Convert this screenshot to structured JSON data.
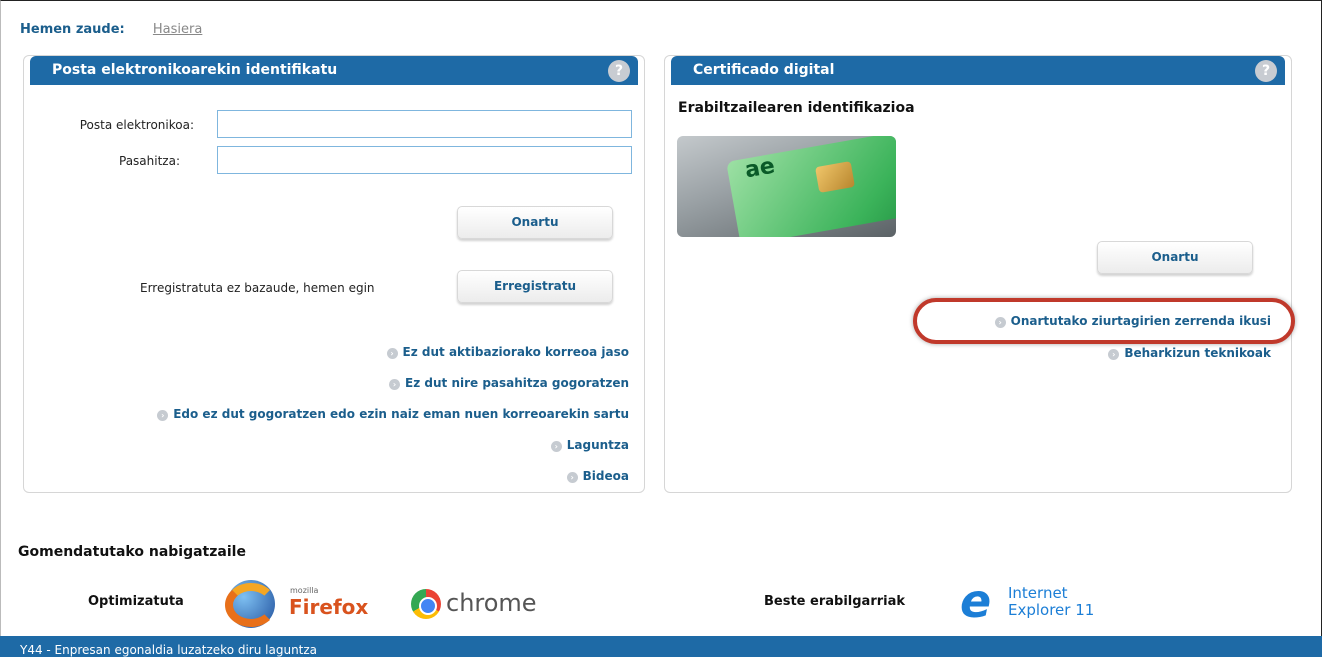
{
  "breadcrumb": {
    "title": "Hemen zaude:",
    "link": "Hasiera"
  },
  "left_panel": {
    "header": "Posta elektronikoarekin identifikatu",
    "help_icon": "?",
    "email_label": "Posta elektronikoa:",
    "email_value": "",
    "password_label": "Pasahitza:",
    "password_value": "",
    "submit_label": "Onartu",
    "register_text": "Erregistratuta ez bazaude, hemen egin",
    "register_label": "Erregistratu",
    "links": [
      "Ez dut aktibaziorako korreoa jaso",
      "Ez dut nire pasahitza gogoratzen",
      "Edo ez dut gogoratzen edo ezin naiz eman nuen korreoarekin sartu",
      "Laguntza",
      "Bideoa"
    ],
    "link_arrow": "›"
  },
  "right_panel": {
    "header": "Certificado digital",
    "help_icon": "?",
    "title": "Erabiltzailearen identifikazioa",
    "card_glyph": "ae",
    "submit_label": "Onartu",
    "links": [
      "Onartutako ziurtagirien zerrenda ikusi",
      "Beharkizun teknikoak"
    ],
    "link_arrow": "›",
    "highlight_color": "#c0392b"
  },
  "browsers": {
    "title": "Gomendatutako nabigatzaile",
    "optimized_label": "Optimizatuta",
    "firefox_brand": "mozilla",
    "firefox_name": "Firefox",
    "chrome_name": "chrome",
    "others_label": "Beste erabilgarriak",
    "ie_name_line1": "Internet",
    "ie_name_line2": "Explorer 11",
    "ie_glyph": "e"
  },
  "footer": {
    "text": "Y44 - Enpresan egonaldia luzatzeko diru laguntza"
  },
  "colors": {
    "accent": "#1e6aa6",
    "link": "#1b5e8c"
  }
}
